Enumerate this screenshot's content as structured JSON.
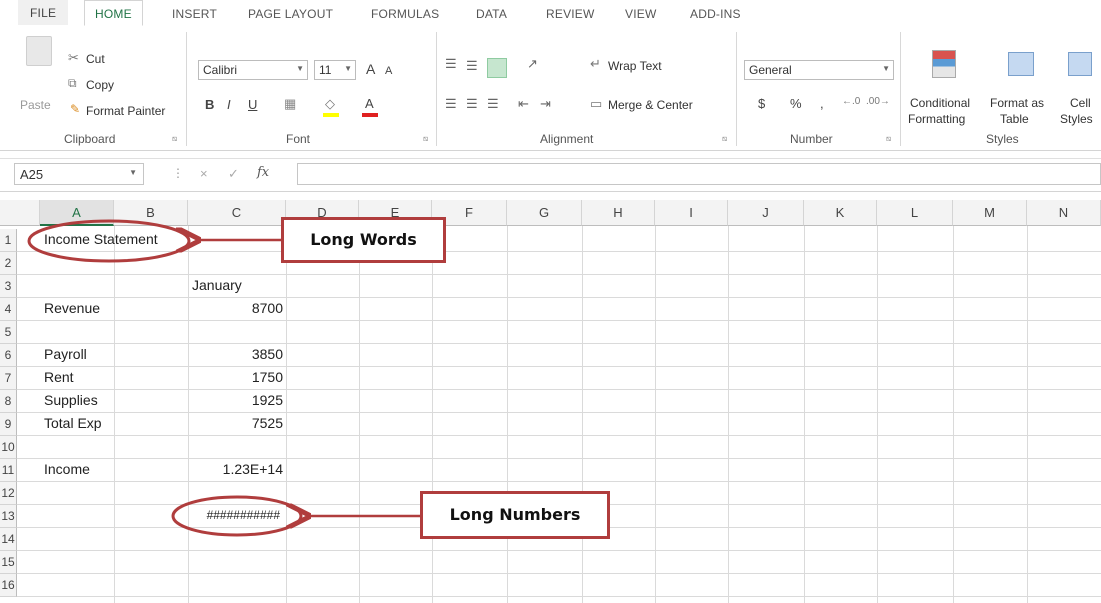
{
  "ribbon_tabs": [
    "FILE",
    "HOME",
    "INSERT",
    "PAGE LAYOUT",
    "FORMULAS",
    "DATA",
    "REVIEW",
    "VIEW",
    "ADD-INS"
  ],
  "clipboard": {
    "paste_label": "Paste",
    "cut_label": "Cut",
    "copy_label": "Copy",
    "format_painter_label": "Format Painter",
    "group_label": "Clipboard"
  },
  "font": {
    "font_name": "Calibri",
    "font_size": "11",
    "bold": "B",
    "italic": "I",
    "underline": "U",
    "grow": "A",
    "shrink": "A",
    "font_color_letter": "A",
    "group_label": "Font"
  },
  "alignment": {
    "wrap_text_label": "Wrap Text",
    "merge_center_label": "Merge & Center",
    "group_label": "Alignment"
  },
  "number": {
    "format_value": "General",
    "currency": "$",
    "percent": "%",
    "comma": ",",
    "group_label": "Number"
  },
  "styles": {
    "conditional_formatting": [
      "Conditional",
      "Formatting"
    ],
    "format_as_table": [
      "Format as",
      "Table"
    ],
    "cell_styles": [
      "Cell",
      "Styles"
    ],
    "group_label": "Styles"
  },
  "formula_bar": {
    "name_box": "A25",
    "fx": "fx",
    "cancel": "×",
    "enter": "✓",
    "content": ""
  },
  "columns": [
    "A",
    "B",
    "C",
    "D",
    "E",
    "F",
    "G",
    "H",
    "I",
    "J",
    "K",
    "L",
    "M",
    "N"
  ],
  "rows": [
    "1",
    "2",
    "3",
    "4",
    "5",
    "6",
    "7",
    "8",
    "9",
    "10",
    "11",
    "12",
    "13",
    "14",
    "15",
    "16"
  ],
  "cells": {
    "A1": "Income Statement",
    "C3": "January",
    "A4": "Revenue",
    "C4": "8700",
    "A6": "Payroll",
    "C6": "3850",
    "A7": "Rent",
    "C7": "1750",
    "A8": "Supplies",
    "C8": "1925",
    "A9": "Total Exp",
    "C9": "7525",
    "A11": "Income",
    "C11": "1.23E+14",
    "C13": "###########"
  },
  "callouts": {
    "long_words": "Long Words",
    "long_numbers": "Long Numbers"
  },
  "colors": {
    "accent": "#217346",
    "annotation": "#b03d3d"
  }
}
